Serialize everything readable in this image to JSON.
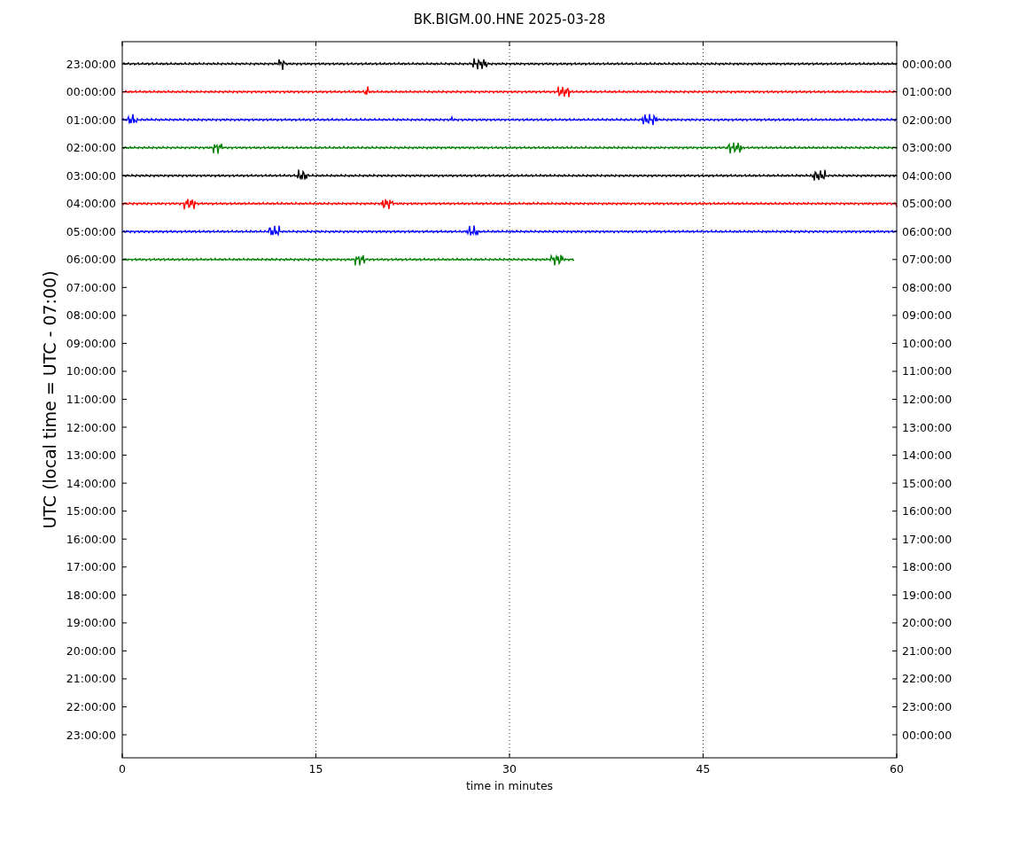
{
  "title": "BK.BIGM.00.HNE 2025-03-28",
  "ylabel": "UTC (local time = UTC - 07:00)",
  "xlabel": "time in minutes",
  "xticks": [
    "0",
    "15",
    "30",
    "45",
    "60"
  ],
  "rows": [
    {
      "left": "23:00:00",
      "right": "00:00:00"
    },
    {
      "left": "00:00:00",
      "right": "01:00:00"
    },
    {
      "left": "01:00:00",
      "right": "02:00:00"
    },
    {
      "left": "02:00:00",
      "right": "03:00:00"
    },
    {
      "left": "03:00:00",
      "right": "04:00:00"
    },
    {
      "left": "04:00:00",
      "right": "05:00:00"
    },
    {
      "left": "05:00:00",
      "right": "06:00:00"
    },
    {
      "left": "06:00:00",
      "right": "07:00:00"
    },
    {
      "left": "07:00:00",
      "right": "08:00:00"
    },
    {
      "left": "08:00:00",
      "right": "09:00:00"
    },
    {
      "left": "09:00:00",
      "right": "10:00:00"
    },
    {
      "left": "10:00:00",
      "right": "11:00:00"
    },
    {
      "left": "11:00:00",
      "right": "12:00:00"
    },
    {
      "left": "12:00:00",
      "right": "13:00:00"
    },
    {
      "left": "13:00:00",
      "right": "14:00:00"
    },
    {
      "left": "14:00:00",
      "right": "15:00:00"
    },
    {
      "left": "15:00:00",
      "right": "16:00:00"
    },
    {
      "left": "16:00:00",
      "right": "17:00:00"
    },
    {
      "left": "17:00:00",
      "right": "18:00:00"
    },
    {
      "left": "18:00:00",
      "right": "19:00:00"
    },
    {
      "left": "19:00:00",
      "right": "20:00:00"
    },
    {
      "left": "20:00:00",
      "right": "21:00:00"
    },
    {
      "left": "21:00:00",
      "right": "22:00:00"
    },
    {
      "left": "22:00:00",
      "right": "23:00:00"
    },
    {
      "left": "23:00:00",
      "right": "00:00:00"
    }
  ],
  "traces": [
    {
      "color": "#000000",
      "level": 1
    },
    {
      "color": "#ff0000",
      "level": 1
    },
    {
      "color": "#0000ff",
      "level": 1
    },
    {
      "color": "#008000",
      "level": 1
    },
    {
      "color": "#000000",
      "level": 1
    },
    {
      "color": "#ff0000",
      "level": 1
    },
    {
      "color": "#0000ff",
      "level": 1
    },
    {
      "color": "#008000",
      "level": 0.583
    }
  ]
}
